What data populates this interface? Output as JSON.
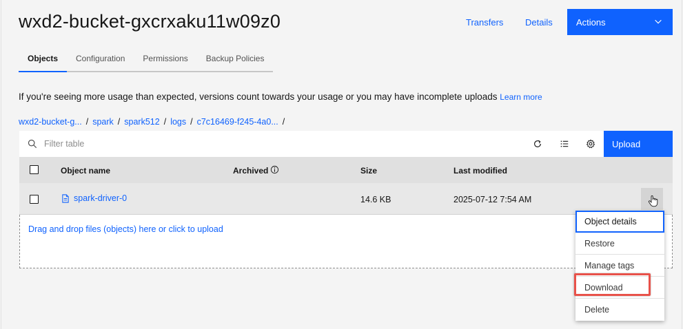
{
  "header": {
    "title": "wxd2-bucket-gxcrxaku11w09z0",
    "transfers_label": "Transfers",
    "details_label": "Details",
    "actions_label": "Actions"
  },
  "tabs": [
    {
      "label": "Objects",
      "active": true
    },
    {
      "label": "Configuration",
      "active": false
    },
    {
      "label": "Permissions",
      "active": false
    },
    {
      "label": "Backup Policies",
      "active": false
    }
  ],
  "notice": {
    "text": "If you're seeing more usage than expected, versions count towards your usage or you may have incomplete uploads",
    "link": "Learn more"
  },
  "breadcrumb": [
    "wxd2-bucket-g...",
    "spark",
    "spark512",
    "logs",
    "c7c16469-f245-4a0..."
  ],
  "breadcrumb_separator": "/",
  "toolbar": {
    "filter_placeholder": "Filter table",
    "upload_label": "Upload"
  },
  "table": {
    "columns": [
      "Object name",
      "Archived",
      "Size",
      "Last modified"
    ],
    "rows": [
      {
        "name": "spark-driver-0",
        "archived": "",
        "size": "14.6 KB",
        "modified": "2025-07-12 7:54 AM"
      }
    ]
  },
  "dropzone": {
    "text": "Drag and drop files (objects) here or click to upload"
  },
  "overflow_menu": {
    "items": [
      "Object details",
      "Restore",
      "Manage tags",
      "Download",
      "Delete"
    ],
    "focused_index": 0,
    "highlighted_index": 3
  },
  "colors": {
    "primary": "#0f62fe",
    "highlight": "#e8524a",
    "background": "#f4f4f4"
  },
  "icons": {
    "actions_chevron": "chevron-down-icon",
    "search": "search-icon",
    "refresh": "refresh-icon",
    "columns": "column-list-icon",
    "settings": "gear-icon",
    "archived_info": "info-icon",
    "file": "document-icon",
    "cursor": "hand-pointer-icon"
  }
}
